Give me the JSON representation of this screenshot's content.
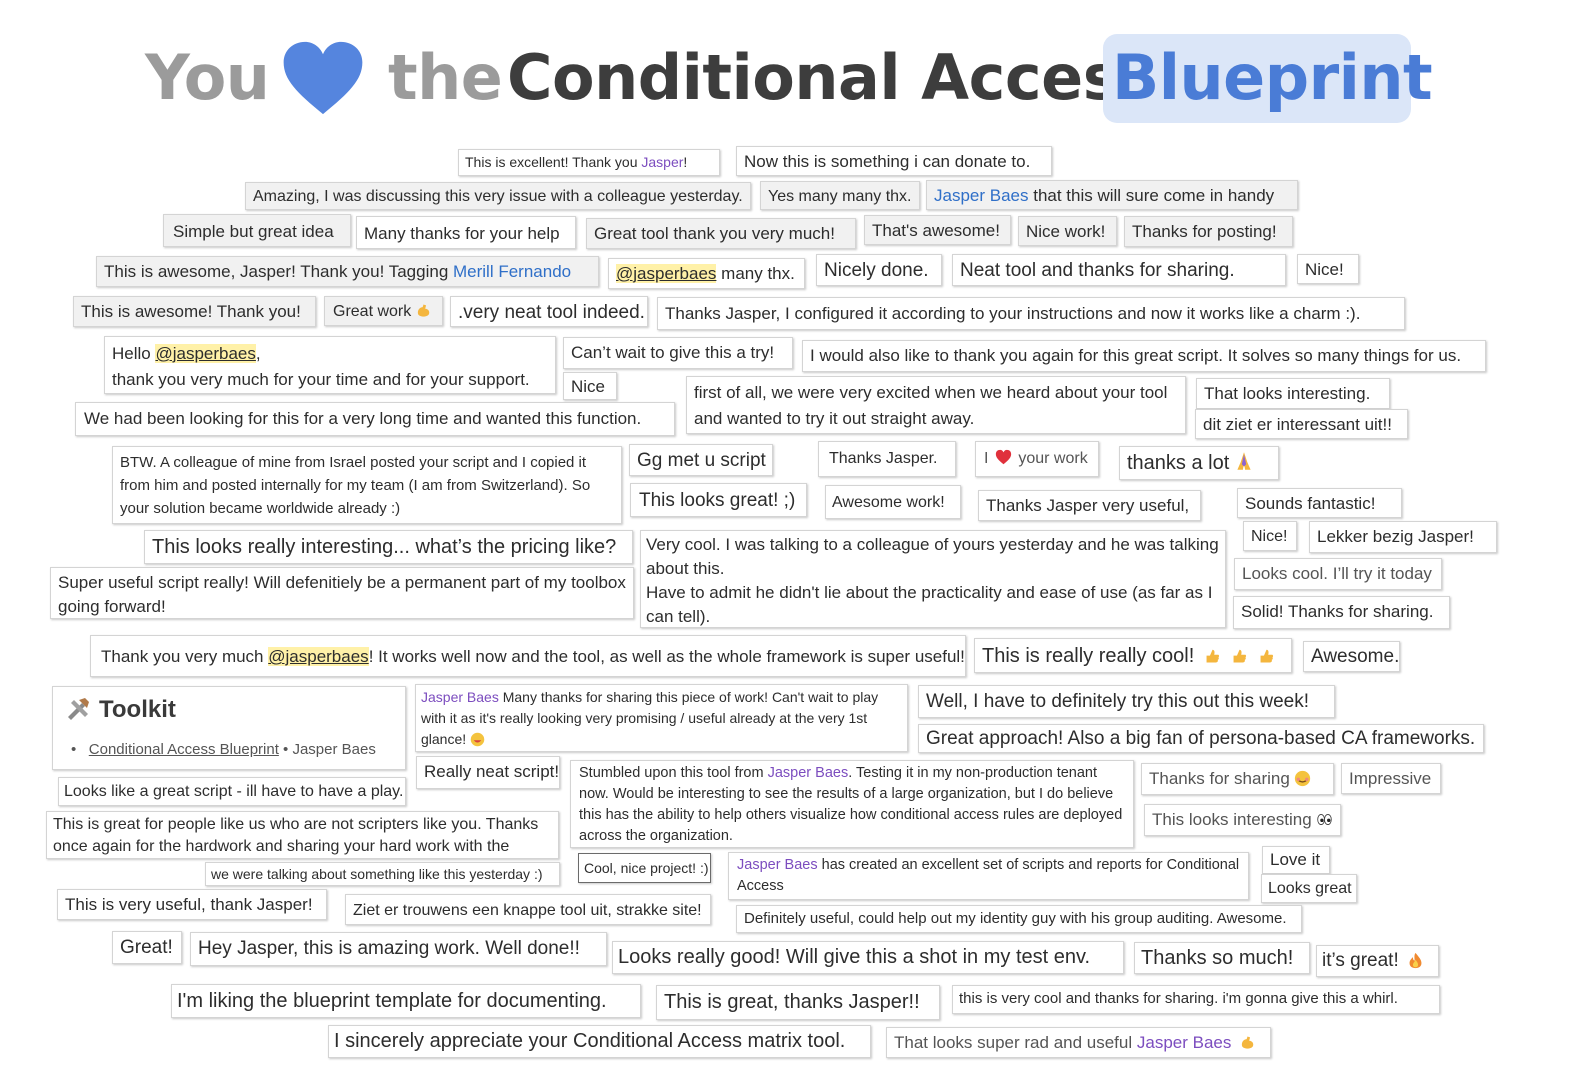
{
  "title": {
    "you": "You",
    "the": "the",
    "conditional_access": "Conditional Access",
    "blueprint": "Blueprint",
    "colors": {
      "gray": "#9b9b9b",
      "dark": "#3d3d3d",
      "blue": "#4a7cd6",
      "highlight": "#dbe6f8",
      "heart": "#5585de"
    }
  },
  "notes": {
    "n1_a": "This is excellent! Thank you ",
    "n1_name": "Jasper",
    "n1_b": "!",
    "n2": "Now this is something i can donate to.",
    "n3": "Amazing, I was discussing this very issue with a colleague yesterday.",
    "n4": "Yes many many thx.",
    "n5_name": "Jasper Baes",
    "n5_b": " that this will sure come in handy",
    "n6": "Simple but great idea",
    "n7": "Many thanks for your help",
    "n8": "Great tool thank you very much!",
    "n9": "That's awesome!",
    "n10": "Nice work!",
    "n11": "Thanks for posting!",
    "n12_a": "This is awesome, Jasper! Thank you! Tagging ",
    "n12_name": "Merill Fernando",
    "n13_mention": "@jasperbaes",
    "n13_b": " many thx.",
    "n14": "Nicely done.",
    "n15": "Neat tool and thanks for sharing.",
    "n16": "Nice!",
    "n17": "This is awesome! Thank you!",
    "n18": "Great work",
    "n19": ".very neat tool indeed.",
    "n20": "Thanks Jasper, I configured it according to your instructions and now it works like a charm :).",
    "n21_a": "Hello ",
    "n21_mention": "@jasperbaes",
    "n21_b": ",",
    "n21_c": "thank you very much for your time and for your support.",
    "n22": "Can’t wait to give this a try!",
    "n23": "I would also like to thank you again for this great script. It solves so many things for us.",
    "n24": "Nice",
    "n25": "first of all, we were very excited when we heard about your tool and wanted to try it out straight away.",
    "n26": "That looks interesting.",
    "n27": "We had been looking for this for a very long time and wanted this function.",
    "n28": "dit ziet er interessant uit!!",
    "n29": "BTW. A colleague of mine from Israel posted your script and I copied it from him and posted internally for my team (I am from Switzerland). So your solution became worldwide already :)",
    "n30": "Gg met u script",
    "n31": "Thanks Jasper.",
    "n32_a": "I",
    "n32_b": "your work",
    "n33": "thanks a lot",
    "n34": "This looks great! ;)",
    "n35": "Awesome work!",
    "n36": "Thanks Jasper very useful,",
    "n37": "Sounds fantastic!",
    "n38": "This looks really interesting... what’s the pricing like?",
    "n39": "Very cool. I was talking to a colleague of yours yesterday and he was talking about this.",
    "n39_b": "Have to admit he didn't lie about the practicality and ease of use (as far as I can tell).",
    "n40": "Nice!",
    "n41": "Lekker bezig Jasper!",
    "n42": "Super useful script really! Will defenitiely be a permanent part of my toolbox going forward!",
    "n43": "Looks cool. I’ll try it today",
    "n44": "Solid! Thanks for sharing.",
    "n45_a": "Thank you very much ",
    "n45_mention": "@jasperbaes",
    "n45_b": "! It works well now and the tool, as well as the whole framework is super useful!",
    "n46": "This is really really cool!",
    "n47": "Awesome.",
    "n48_name": "Jasper Baes",
    "n48_b": " Many thanks for sharing this piece of work! Can't wait to play with it as it's really looking very promising / useful already at the very 1st glance!",
    "n49": "Well, I have to definitely try this out this week!",
    "n50": "Great approach! Also a big fan of persona-based CA frameworks.",
    "n51": "Looks like a great script - ill have to have a play.",
    "n52": "Really neat script!",
    "n53_a": "Stumbled upon this tool from ",
    "n53_name": "Jasper Baes",
    "n53_b": ". Testing it in my non-production tenant now. Would be interesting to see the results of a large organization, but I do believe this has the ability to help others visualize how conditional access rules are deployed across the organization.",
    "n54": "Thanks for sharing",
    "n55": "Impressive",
    "n56": "This looks interesting",
    "n57": "This is great for people like us who are not scripters like you. Thanks once again for the hardwork and sharing your hard work with the public",
    "n58": "we were talking about something like this yesterday :)",
    "n59": "Cool, nice project! :)",
    "n60_name": "Jasper Baes",
    "n60_b": " has created an excellent set of scripts and reports for Conditional Access",
    "n61": "Love it",
    "n62": "Looks great",
    "n63": "This is very useful, thank Jasper!",
    "n64": "Ziet er trouwens een knappe tool uit, strakke site!",
    "n65": "Definitely useful, could help out my identity guy with his group auditing. Awesome.",
    "n66": "Great!",
    "n67": "Hey Jasper, this is amazing work. Well done!!",
    "n68": "Looks really good! Will give this a shot in my test env.",
    "n69": "Thanks so much!",
    "n70": "it’s great!",
    "n71": "I'm liking the blueprint template for documenting.",
    "n72": "This is great, thanks Jasper!!",
    "n73": "this is very cool and thanks for sharing. i'm gonna give this a whirl.",
    "n74": "I sincerely appreciate your Conditional Access matrix tool.",
    "n75_a": "That looks super rad and useful ",
    "n75_name": "Jasper Baes"
  },
  "toolkit": {
    "title": "Toolkit",
    "icon": "tools-icon",
    "link": "Conditional Access Blueprint",
    "sep": " • ",
    "author": "Jasper Baes"
  },
  "icons": [
    "heart-icon",
    "muscle-emoji",
    "red-heart-emoji",
    "pray-emoji",
    "thumbs-up-emoji",
    "grin-emoji",
    "blush-emoji",
    "eyes-emoji",
    "fire-emoji"
  ]
}
